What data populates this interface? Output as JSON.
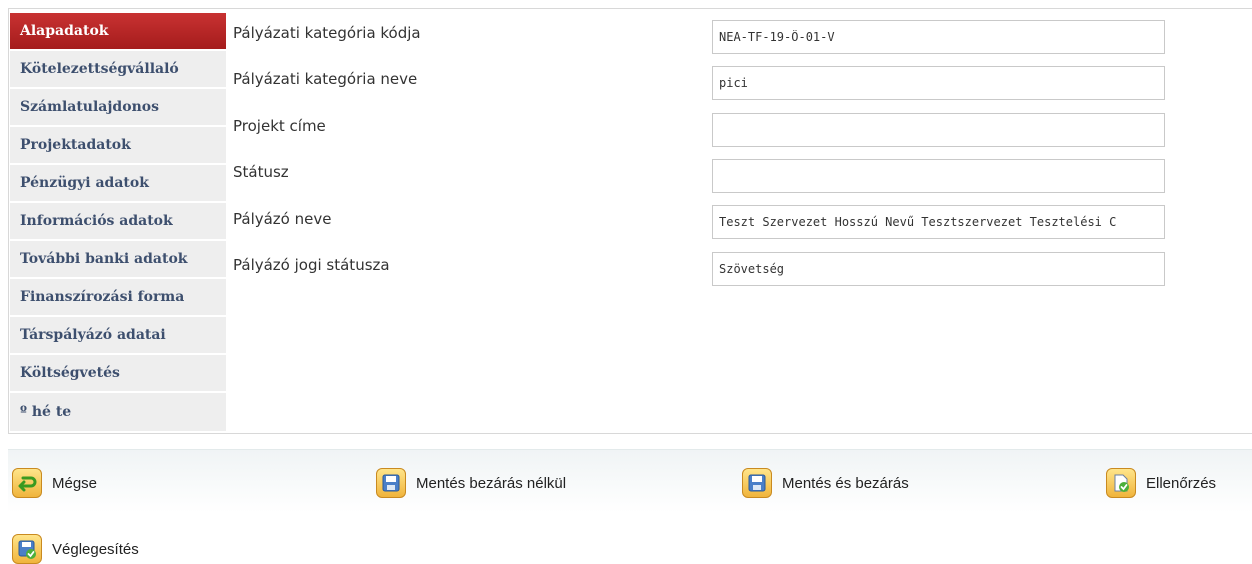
{
  "nav": {
    "items": [
      {
        "label": "Alapadatok",
        "active": true
      },
      {
        "label": "Kötelezettségvállaló"
      },
      {
        "label": "Számlatulajdonos"
      },
      {
        "label": "Projektadatok"
      },
      {
        "label": "Pénzügyi adatok"
      },
      {
        "label": "Információs adatok"
      },
      {
        "label": "További banki adatok"
      },
      {
        "label": "Finanszírozási forma"
      },
      {
        "label": "Társpályázó adatai"
      },
      {
        "label": "Költségvetés"
      },
      {
        "label": "º hé te"
      }
    ]
  },
  "form": {
    "fields": [
      {
        "label": "Pályázati kategória kódja",
        "value": "NEA-TF-19-Ö-01-V"
      },
      {
        "label": "Pályázati kategória neve",
        "value": "pici"
      },
      {
        "label": "Projekt címe",
        "value": ""
      },
      {
        "label": "Státusz",
        "value": ""
      },
      {
        "label": "Pályázó neve",
        "value": "Teszt Szervezet Hosszú Nevű Tesztszervezet Tesztelési C"
      },
      {
        "label": "Pályázó jogi státusza",
        "value": "Szövetség"
      }
    ]
  },
  "toolbar": {
    "cancel": "Mégse",
    "save_no_close": "Mentés bezárás nélkül",
    "save_close": "Mentés és bezárás",
    "check": "Ellenőrzés",
    "finalize": "Véglegesítés"
  },
  "colors": {
    "nav_active": "#b52424",
    "nav_text": "#3d4f6e",
    "nav_bg": "#eeeeee"
  }
}
